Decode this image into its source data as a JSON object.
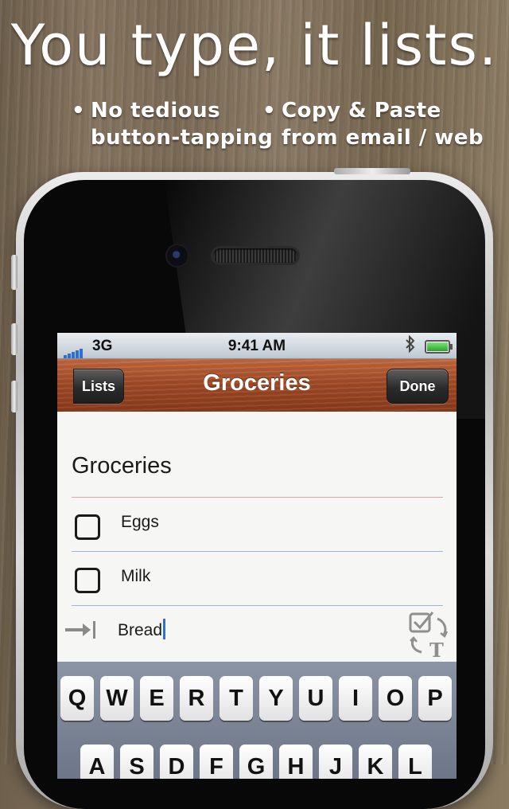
{
  "promo": {
    "headline": "You type, it lists.",
    "bullets": [
      {
        "line1": "No tedious",
        "line2": "button-tapping"
      },
      {
        "line1": "Copy & Paste",
        "line2": "from email / web"
      }
    ]
  },
  "status_bar": {
    "network": "3G",
    "time": "9:41 AM",
    "bluetooth_icon": "bluetooth-icon",
    "battery_level": 1.0
  },
  "nav": {
    "back_label": "Lists",
    "title": "Groceries",
    "done_label": "Done"
  },
  "list": {
    "title": "Groceries",
    "items": [
      {
        "label": "Eggs",
        "checked": false
      },
      {
        "label": "Milk",
        "checked": false
      }
    ],
    "entry_value": "Bread",
    "convert_icon": "check-to-text-icon"
  },
  "keyboard": {
    "row1": [
      "Q",
      "W",
      "E",
      "R",
      "T",
      "Y",
      "U",
      "I",
      "O",
      "P"
    ],
    "row2": [
      "A",
      "S",
      "D",
      "F",
      "G",
      "H",
      "J",
      "K",
      "L"
    ]
  },
  "colors": {
    "nav_bar": "#a24b27",
    "accent_blue": "#2f6fd3"
  }
}
